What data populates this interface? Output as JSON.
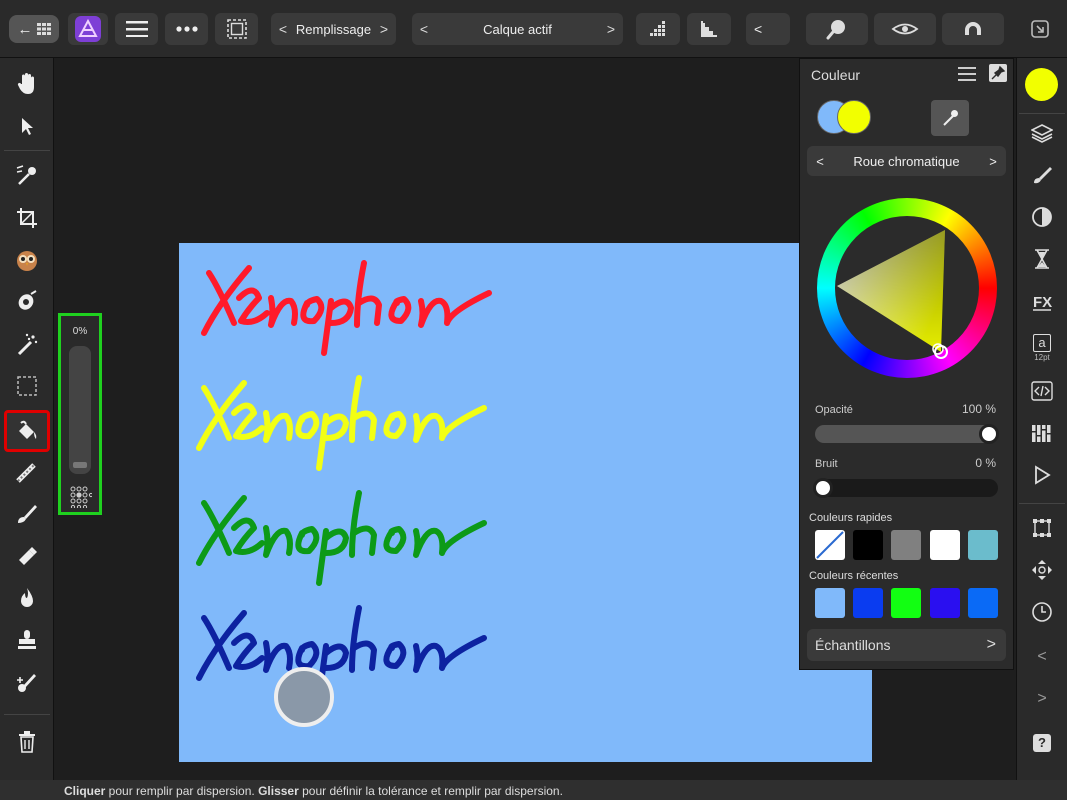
{
  "toolbar": {
    "back_label": "←",
    "fill_mode": "Remplissage",
    "layer_target": "Calque actif"
  },
  "tolerance": {
    "value": "0%"
  },
  "color_panel": {
    "title": "Couleur",
    "mode": "Roue chromatique",
    "opacity_label": "Opacité",
    "opacity_value": "100 %",
    "opacity": 1.0,
    "noise_label": "Bruit",
    "noise_value": "0 %",
    "noise": 0.0,
    "quick_colors_label": "Couleurs rapides",
    "quick_colors": [
      "none",
      "#000000",
      "#808080",
      "#ffffff",
      "#6bbccc"
    ],
    "recent_colors_label": "Couleurs récentes",
    "recent_colors": [
      "#80b9fa",
      "#0a3cf0",
      "#12ff12",
      "#2a0ff0",
      "#0a6af6"
    ],
    "samples_label": "Échantillons",
    "primary_color": "#80b9fa",
    "secondary_color": "#f2ff00"
  },
  "current_color": "#f2ff00",
  "canvas": {
    "background": "#80b9fa",
    "words": [
      {
        "text": "Xenophon",
        "color": "#ff1a2a"
      },
      {
        "text": "Xenophon",
        "color": "#f2ff14"
      },
      {
        "text": "Xenophon",
        "color": "#0d9a17"
      },
      {
        "text": "Xenophon",
        "color": "#0d22a0"
      }
    ]
  },
  "rightbar": {
    "text_size_label": "12pt",
    "text_icon_letter": "a",
    "help": "?"
  },
  "status": {
    "click": "Cliquer",
    "click_desc": " pour remplir par dispersion. ",
    "drag": "Glisser",
    "drag_desc": " pour définir la tolérance et remplir par dispersion."
  }
}
